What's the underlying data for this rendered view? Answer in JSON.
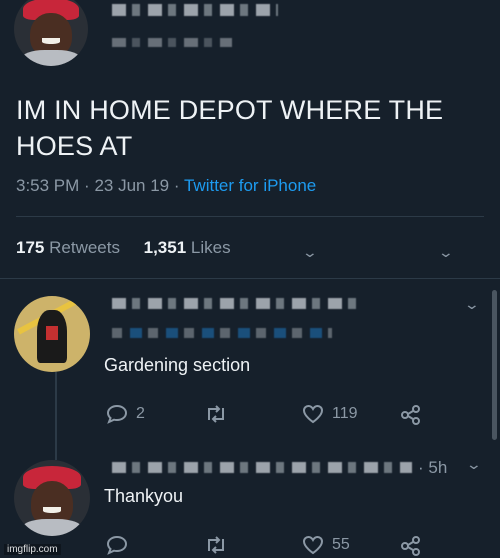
{
  "main_tweet": {
    "text": "IM IN HOME DEPOT WHERE THE HOES AT",
    "time": "3:53 PM",
    "date": "23 Jun 19",
    "source": "Twitter for iPhone",
    "retweets_count": "175",
    "retweets_label": "Retweets",
    "likes_count": "1,351",
    "likes_label": "Likes"
  },
  "replies": [
    {
      "text": "Gardening section",
      "reply_count": "2",
      "like_count": "119"
    },
    {
      "time_ago": "5h",
      "text": "Thankyou",
      "like_count": "55"
    }
  ],
  "separator": "·",
  "watermark": "imgflip.com",
  "colors": {
    "background": "#16202b",
    "link": "#1d9bf0",
    "secondary_text": "#8b98a5",
    "primary_text": "#eef2f5"
  }
}
